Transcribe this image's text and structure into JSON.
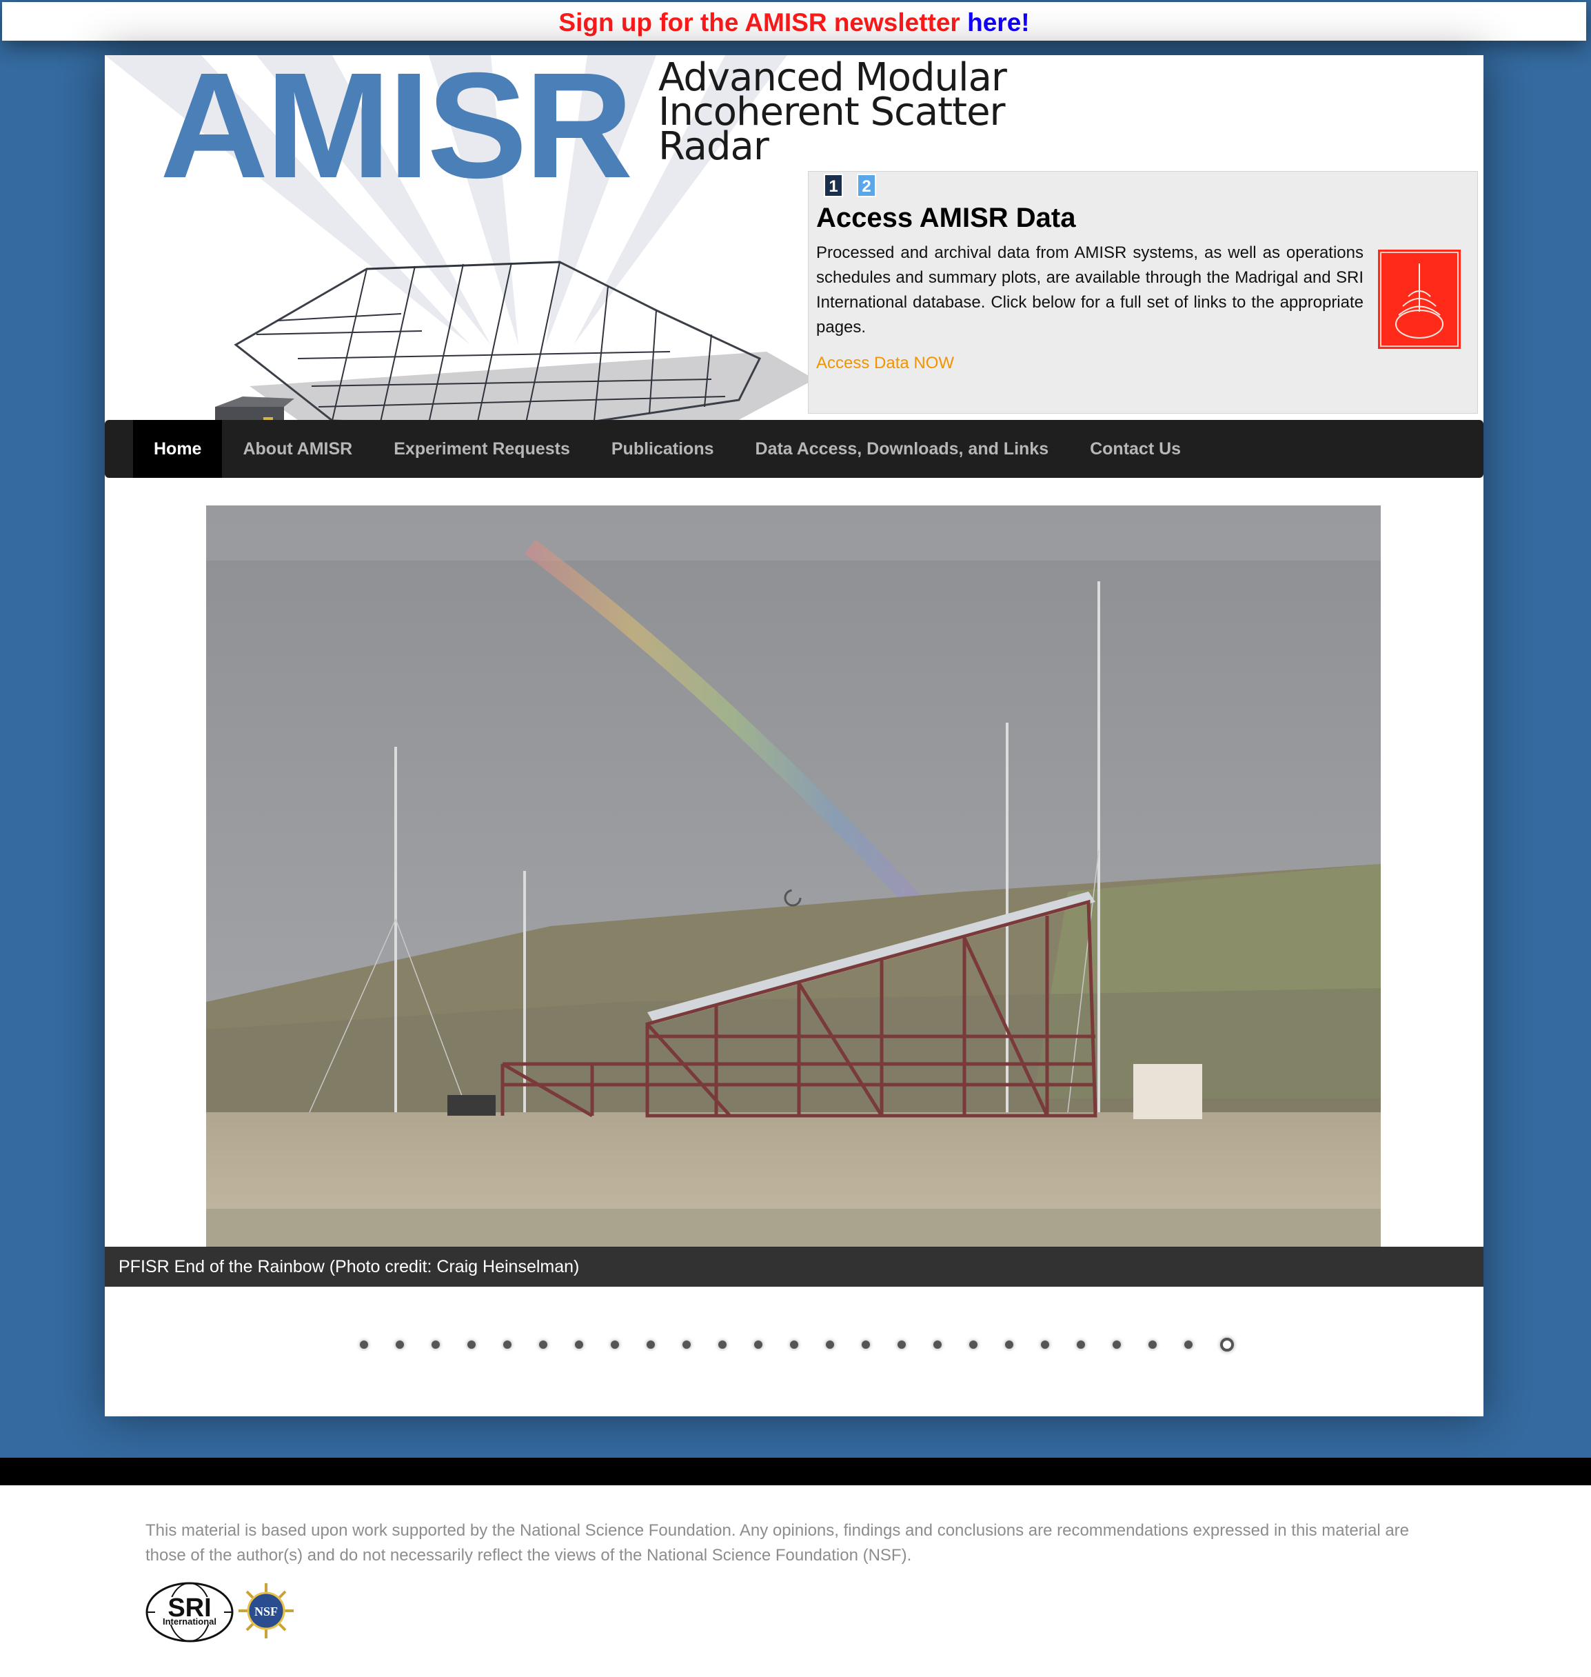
{
  "banner": {
    "text": "Sign up for the AMISR newsletter",
    "link": "here!"
  },
  "header": {
    "logo": "AMISR",
    "subtitle": [
      "Advanced Modular",
      "Incoherent Scatter",
      "Radar"
    ]
  },
  "access": {
    "pager": [
      "1",
      "2"
    ],
    "title": "Access AMISR Data",
    "text": "Processed and archival data from AMISR systems, as well as operations schedules and summary plots, are available through the Madrigal and SRI International database. Click below for a full set of links to the appropriate pages.",
    "link": "Access Data NOW"
  },
  "nav": {
    "items": [
      "Home",
      "About AMISR",
      "Experiment Requests",
      "Publications",
      "Data Access, Downloads, and Links",
      "Contact Us"
    ],
    "active": "Home"
  },
  "slideshow": {
    "caption": "PFISR End of the Rainbow (Photo credit: Craig Heinselman)",
    "dot_count": 25,
    "active_dot": 25
  },
  "footer": {
    "text": "This material is based upon work supported by the National Science Foundation. Any opinions, findings and conclusions are recommendations expressed in this material are those of the author(s) and do not necessarily reflect the views of the National Science Foundation (NSF).",
    "sri_logo_text": "SRI",
    "sri_logo_subtext": "International",
    "nsf_logo_text": "NSF"
  },
  "colors": {
    "background": "#346a9f",
    "banner_red": "#ff1a1a",
    "banner_blue": "#1100ff",
    "logo_blue": "#4a7fb8",
    "link_orange": "#f29400",
    "nav_bg": "#1f1f1f"
  }
}
